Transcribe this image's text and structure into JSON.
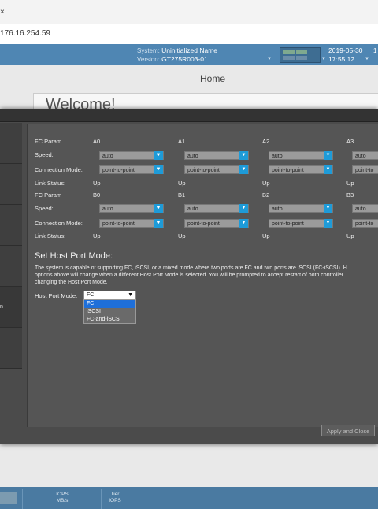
{
  "browser": {
    "url": "176.16.254.59",
    "tab_close_glyph": "×"
  },
  "header": {
    "system_label": "System:",
    "system_value": "Uninitialized Name",
    "version_label": "Version:",
    "version_value": "GT275R003-01",
    "date": "2019-05-30",
    "time": "17:55:12",
    "edge_text": "1"
  },
  "page": {
    "title": "Home",
    "welcome": "Welcome!"
  },
  "fc_params": {
    "rows": {
      "fc_param": "FC Param",
      "speed": "Speed:",
      "connection_mode": "Connection Mode:",
      "link_status": "Link Status:"
    },
    "group_a": {
      "ports": [
        "A0",
        "A1",
        "A2",
        "A3"
      ],
      "speeds": [
        "auto",
        "auto",
        "auto",
        "auto"
      ],
      "modes": [
        "point-to-point",
        "point-to-point",
        "point-to-point",
        "point-to"
      ],
      "link": [
        "Up",
        "Up",
        "Up",
        "Up"
      ]
    },
    "group_b": {
      "ports": [
        "B0",
        "B1",
        "B2",
        "B3"
      ],
      "speeds": [
        "auto",
        "auto",
        "auto",
        "auto"
      ],
      "modes": [
        "point-to-point",
        "point-to-point",
        "point-to-point",
        "point-to"
      ],
      "link": [
        "Up",
        "Up",
        "Up",
        "Up"
      ]
    }
  },
  "host_port_mode": {
    "title": "Set Host Port Mode:",
    "description_lines": [
      "The system is capable of supporting FC, iSCSI, or a mixed mode where two ports are FC and two ports are iSCSI (FC-iSCSI). H",
      "options above will change when a different Host Port Mode is selected. You will be prompted to accept restart of both controller",
      "changing the Host Port Mode."
    ],
    "label": "Host Port Mode:",
    "selected": "FC",
    "options": [
      "FC",
      "iSCSI",
      "FC-and-iSCSI"
    ]
  },
  "nav": {
    "active_item_fragment": "n"
  },
  "buttons": {
    "apply_close": "Apply and Close"
  },
  "footer": {
    "iops_label": "IOPS",
    "mbs_label": "MB/s",
    "tier_label": "Tier",
    "tier_iops_label": "IOPS"
  },
  "colors": {
    "header_blue": "#4f86b3",
    "select_accent": "#1e9bd8",
    "modal_bg": "#4b4b4b",
    "highlight": "#1e6fd9"
  },
  "icons": [
    "close-icon",
    "array-status-icon",
    "dropdown-arrow-icon",
    "caret-down-icon"
  ]
}
